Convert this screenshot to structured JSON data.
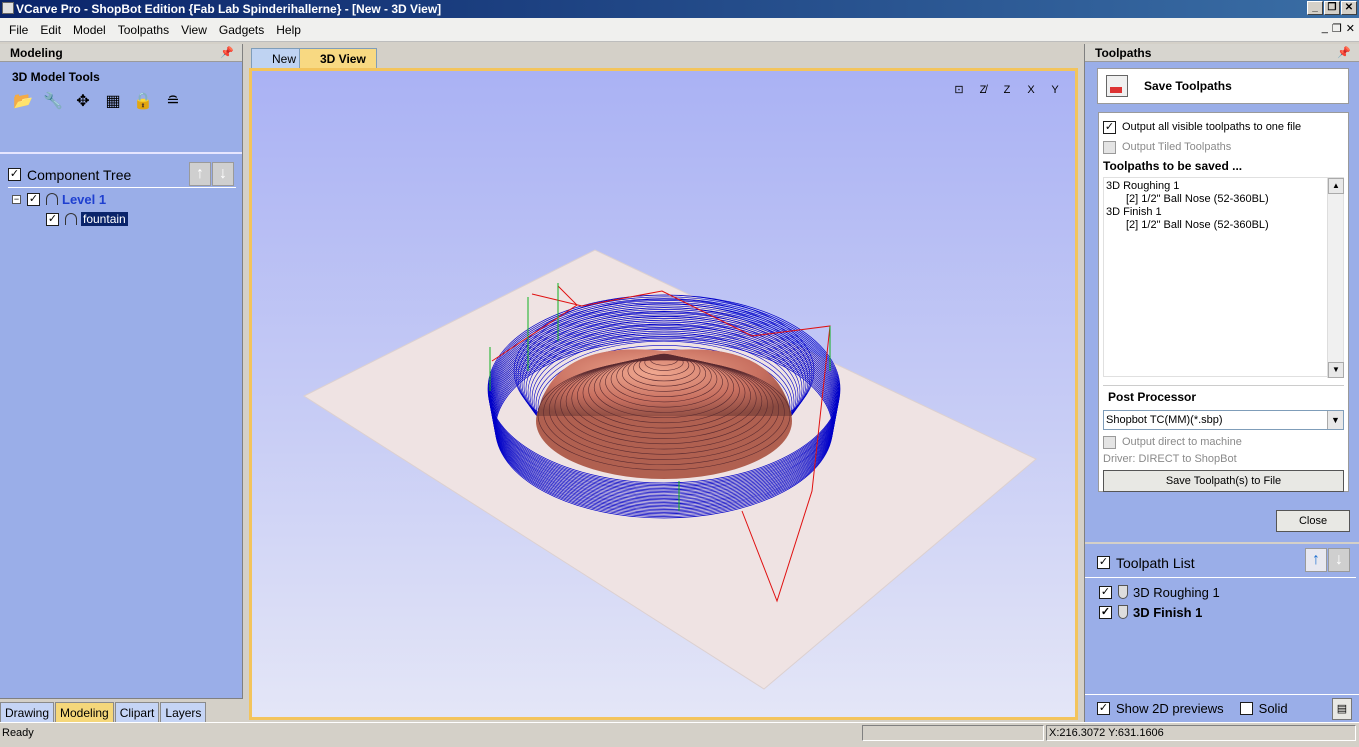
{
  "window": {
    "title": "VCarve Pro - ShopBot Edition {Fab Lab Spinderihallerne} - [New - 3D View]",
    "buttons": [
      "_",
      "❐",
      "✕"
    ]
  },
  "menu": {
    "items": [
      "File",
      "Edit",
      "Model",
      "Toolpaths",
      "View",
      "Gadgets",
      "Help"
    ],
    "mdi_buttons": [
      "_",
      "❐",
      "✕"
    ]
  },
  "left_panel": {
    "title": "Modeling",
    "model_tools_label": "3D Model Tools",
    "tools": [
      {
        "icon": "open-folder-icon",
        "glyph": "📂"
      },
      {
        "icon": "wrench-icon",
        "glyph": "🔧"
      },
      {
        "icon": "move-arrows-icon",
        "glyph": "✥"
      },
      {
        "icon": "grid-icon",
        "glyph": "▦"
      },
      {
        "icon": "lock-shape-icon",
        "glyph": "🔒"
      },
      {
        "icon": "layers-icon",
        "glyph": "≘"
      }
    ],
    "component_tree": {
      "title": "Component Tree",
      "level_name": "Level 1",
      "component_name": "fountain"
    },
    "tabs": [
      "Drawing",
      "Modeling",
      "Clipart",
      "Layers"
    ],
    "active_tab": "Modeling"
  },
  "center": {
    "tabs": [
      "New",
      "3D View"
    ],
    "active_tab": "3D View",
    "view_icons": [
      "⊡",
      "Z̸",
      "Z",
      "X",
      "Y"
    ]
  },
  "right_panel": {
    "title": "Toolpaths",
    "save_title": "Save Toolpaths",
    "output_all_label": "Output all visible toolpaths to one file",
    "output_tiled_label": "Output Tiled Toolpaths",
    "to_be_saved_label": "Toolpaths to be saved ...",
    "toolpaths": [
      {
        "name": "3D Roughing 1",
        "tool": "[2] 1/2\" Ball Nose  (52-360BL)"
      },
      {
        "name": "3D Finish 1",
        "tool": "[2] 1/2\" Ball Nose  (52-360BL)"
      }
    ],
    "post_processor_label": "Post Processor",
    "post_processor_value": "Shopbot TC(MM)(*.sbp)",
    "output_direct_label": "Output direct to machine",
    "driver_label": "Driver: DIRECT to ShopBot",
    "save_file_button": "Save Toolpath(s) to File",
    "close_button": "Close",
    "toolpath_list_title": "Toolpath List",
    "toolpath_list": [
      "3D Roughing 1",
      "3D Finish 1"
    ],
    "show_previews_label": "Show 2D previews",
    "solid_label": "Solid"
  },
  "status": {
    "ready": "Ready",
    "coords": "X:216.3072 Y:631.1606"
  },
  "colors": {
    "panel": "#9aaee8",
    "toolpath": "#0000c8",
    "model": "#c87060",
    "rapid": "#e01010",
    "plunge": "#10b020"
  }
}
